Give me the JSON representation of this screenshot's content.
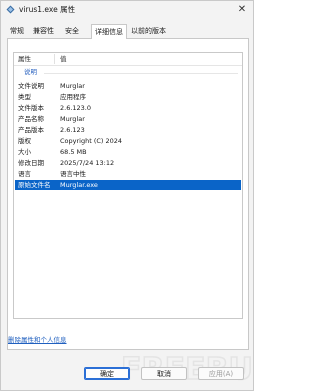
{
  "window": {
    "title": "virus1.exe 属性",
    "close_glyph": "✕"
  },
  "tabs": [
    {
      "label": "常规",
      "active": false
    },
    {
      "label": "兼容性",
      "active": false
    },
    {
      "label": "安全",
      "active": false
    },
    {
      "label": "详细信息",
      "active": true
    },
    {
      "label": "以前的版本",
      "active": false
    }
  ],
  "details": {
    "columns": {
      "property": "属性",
      "value": "值"
    },
    "section": "说明",
    "rows": [
      {
        "property": "文件说明",
        "value": "Murglar",
        "selected": false
      },
      {
        "property": "类型",
        "value": "应用程序",
        "selected": false
      },
      {
        "property": "文件版本",
        "value": "2.6.123.0",
        "selected": false
      },
      {
        "property": "产品名称",
        "value": "Murglar",
        "selected": false
      },
      {
        "property": "产品版本",
        "value": "2.6.123",
        "selected": false
      },
      {
        "property": "版权",
        "value": "Copyright (C) 2024",
        "selected": false
      },
      {
        "property": "大小",
        "value": "68.5 MB",
        "selected": false
      },
      {
        "property": "修改日期",
        "value": "2025/7/24 13:12",
        "selected": false
      },
      {
        "property": "语言",
        "value": "语言中性",
        "selected": false
      },
      {
        "property": "原始文件名",
        "value": "Murglar.exe",
        "selected": true
      }
    ]
  },
  "link": "删除属性和个人信息",
  "buttons": {
    "ok": "确定",
    "cancel": "取消",
    "apply": "应用(A)"
  },
  "watermark": "FREEBUF",
  "colors": {
    "accent": "#0a64c8",
    "link": "#1f5fbf",
    "section": "#2b63c0"
  }
}
